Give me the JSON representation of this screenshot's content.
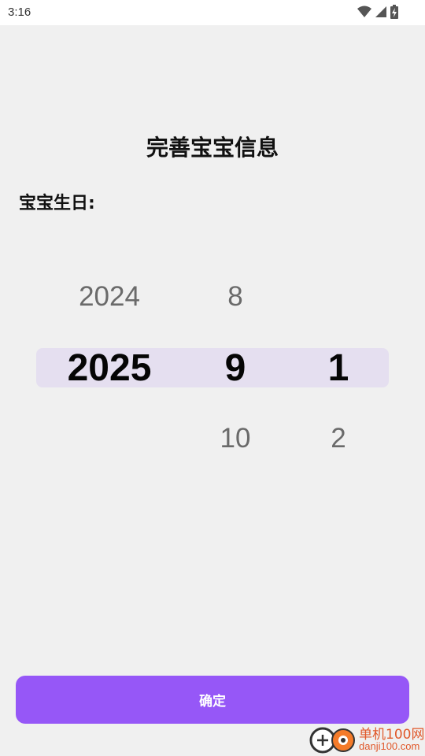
{
  "status_bar": {
    "time": "3:16"
  },
  "title": "完善宝宝信息",
  "birthday_label": "宝宝生日:",
  "picker": {
    "year": {
      "prev": "2024",
      "selected": "2025",
      "next": ""
    },
    "month": {
      "prev": "8",
      "selected": "9",
      "next": "10"
    },
    "day": {
      "prev": "",
      "selected": "1",
      "next": "2"
    }
  },
  "confirm_button": "确定",
  "watermark": {
    "cn": "单机100网",
    "en": "danji100.com"
  },
  "colors": {
    "accent": "#9657f7",
    "highlight": "#e5dff0",
    "background": "#f0f0f0"
  }
}
